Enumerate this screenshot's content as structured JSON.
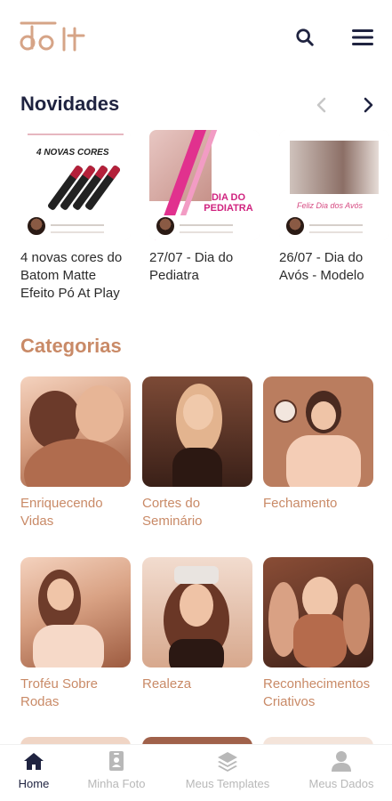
{
  "app": {
    "logo_text": "do it",
    "brand_color": "#c98a67",
    "primary_color": "#1f2340"
  },
  "header": {
    "search_icon": "search-icon",
    "menu_icon": "hamburger-menu-icon"
  },
  "novidades": {
    "title": "Novidades",
    "prev_icon": "chevron-left-icon",
    "next_icon": "chevron-right-icon",
    "cards": [
      {
        "label": "4 novas cores do Batom Matte Efeito Pó At Play",
        "thumb_title": "4 NOVAS CORES"
      },
      {
        "label": "27/07 - Dia do Pediatra",
        "thumb_title": "DIA DO PEDIATRA"
      },
      {
        "label": "26/07 - Dia do Avós - Modelo",
        "thumb_title": "Feliz Dia dos Avós"
      }
    ]
  },
  "categorias": {
    "title": "Categorias",
    "items": [
      {
        "label": "Enriquecendo Vidas"
      },
      {
        "label": "Cortes do Seminário"
      },
      {
        "label": "Fechamento"
      },
      {
        "label": "Troféu Sobre Rodas"
      },
      {
        "label": "Realeza"
      },
      {
        "label": "Reconhecimentos Criativos"
      }
    ]
  },
  "bottom_nav": {
    "items": [
      {
        "label": "Home",
        "icon": "home-icon",
        "active": true
      },
      {
        "label": "Minha Foto",
        "icon": "photo-badge-icon",
        "active": false
      },
      {
        "label": "Meus Templates",
        "icon": "layers-icon",
        "active": false
      },
      {
        "label": "Meus Dados",
        "icon": "user-icon",
        "active": false
      }
    ]
  }
}
